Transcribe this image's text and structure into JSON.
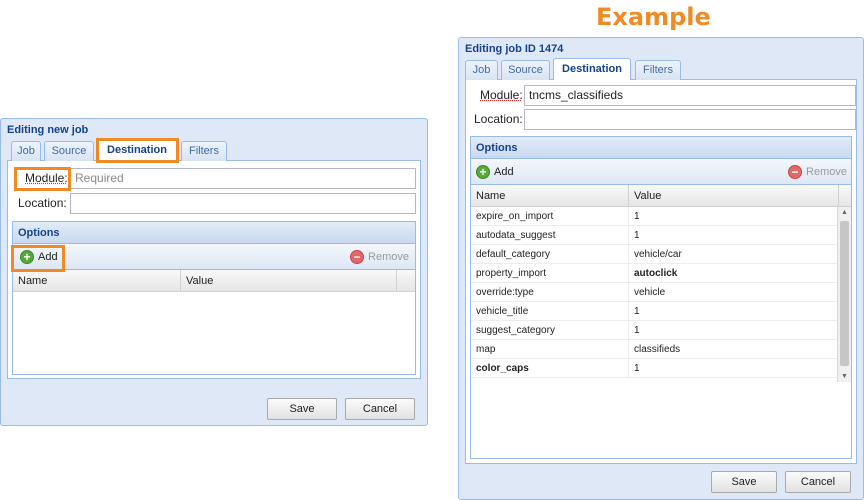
{
  "heading": "Example",
  "left_window": {
    "title": "Editing new job",
    "tabs": [
      "Job",
      "Source",
      "Destination",
      "Filters"
    ],
    "active_tab": "Destination",
    "module_label": "Module:",
    "module_placeholder": "Required",
    "location_label": "Location:",
    "location_value": "",
    "options_title": "Options",
    "add_label": "Add",
    "remove_label": "Remove",
    "grid_columns": [
      "Name",
      "Value"
    ],
    "save_label": "Save",
    "cancel_label": "Cancel"
  },
  "right_window": {
    "title": "Editing job ID 1474",
    "tabs": [
      "Job",
      "Source",
      "Destination",
      "Filters"
    ],
    "active_tab": "Destination",
    "module_label": "Module:",
    "module_value": "tncms_classifieds",
    "location_label": "Location:",
    "location_value": "",
    "options_title": "Options",
    "add_label": "Add",
    "remove_label": "Remove",
    "grid_columns": [
      "Name",
      "Value"
    ],
    "rows": [
      {
        "name": "expire_on_import",
        "value": "1",
        "name_bold": false,
        "value_bold": false
      },
      {
        "name": "autodata_suggest",
        "value": "1",
        "name_bold": false,
        "value_bold": false
      },
      {
        "name": "default_category",
        "value": "vehicle/car",
        "name_bold": false,
        "value_bold": false
      },
      {
        "name": "property_import",
        "value": "autoclick",
        "name_bold": false,
        "value_bold": true
      },
      {
        "name": "override:type",
        "value": "vehicle",
        "name_bold": false,
        "value_bold": false
      },
      {
        "name": "vehicle_title",
        "value": "1",
        "name_bold": false,
        "value_bold": false
      },
      {
        "name": "suggest_category",
        "value": "1",
        "name_bold": false,
        "value_bold": false
      },
      {
        "name": "map",
        "value": "classifieds",
        "name_bold": false,
        "value_bold": false
      },
      {
        "name": "color_caps",
        "value": "1",
        "name_bold": true,
        "value_bold": false
      }
    ],
    "save_label": "Save",
    "cancel_label": "Cancel"
  },
  "colors": {
    "highlight": "#f08a24",
    "window_bg": "#dfe8f6",
    "title_text": "#15428b",
    "border": "#99bbe8"
  },
  "icons": {
    "add": "add-circle-icon",
    "remove": "remove-circle-icon"
  }
}
